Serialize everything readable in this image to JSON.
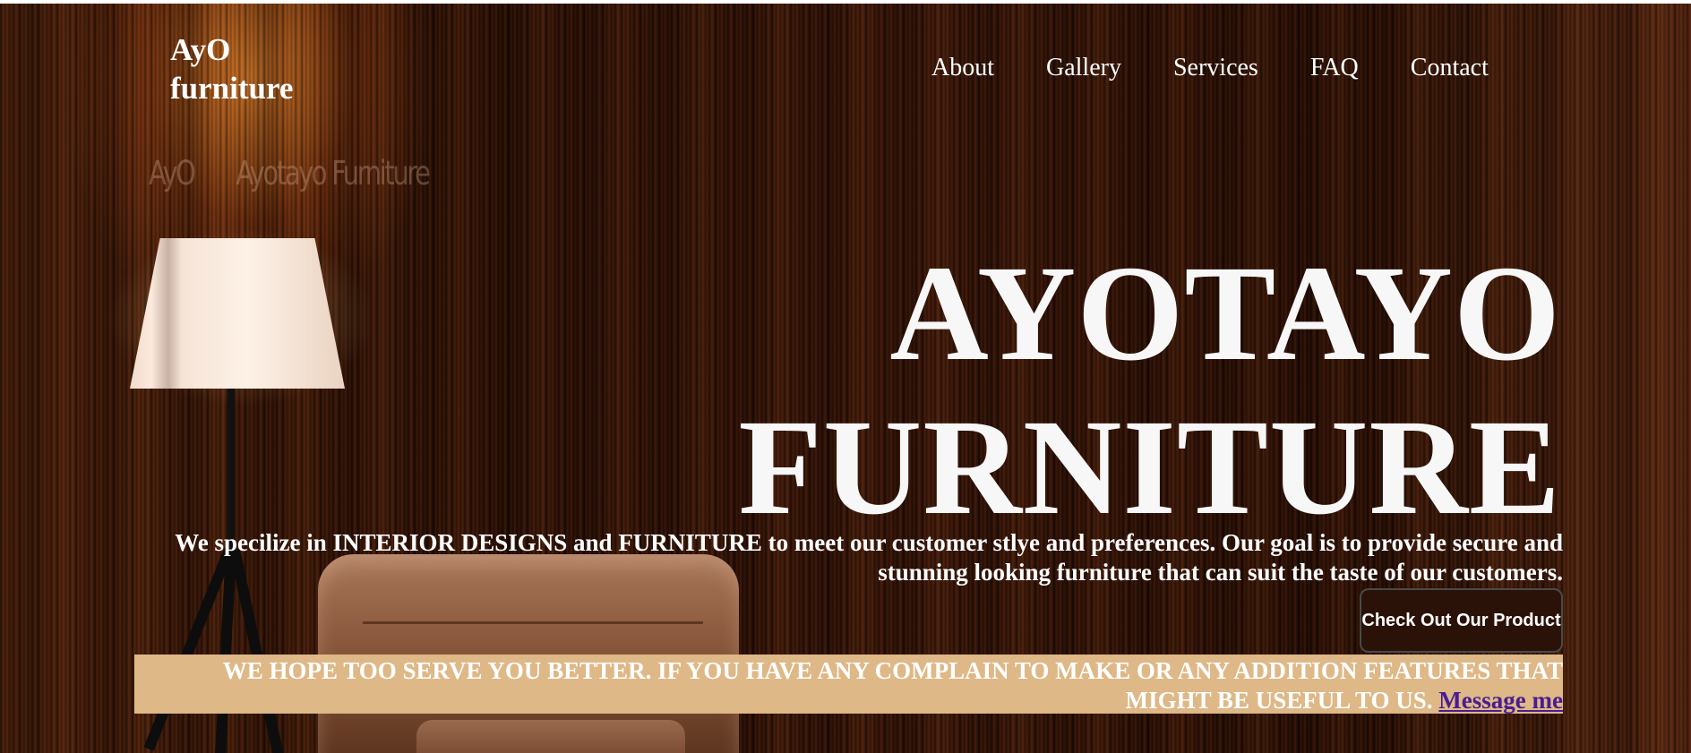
{
  "header": {
    "logo_line1": "AyO",
    "logo_line2": "furniture",
    "nav": [
      {
        "label": "About"
      },
      {
        "label": "Gallery"
      },
      {
        "label": "Services"
      },
      {
        "label": "FAQ"
      },
      {
        "label": "Contact"
      }
    ]
  },
  "watermark": {
    "left": "AyO",
    "right": "Ayotayo Furniture"
  },
  "hero": {
    "title_line1": "AYOTAYO",
    "title_line2": "FURNITURE",
    "tagline": "We specilize in INTERIOR DESIGNS and FURNITURE to meet our customer stlye and preferences. Our goal is to provide secure and stunning looking furniture that can suit the taste of our customers.",
    "cta_label": "Check Out Our Product"
  },
  "banner": {
    "text": "WE HOPE TOO SERVE YOU BETTER. IF YOU HAVE ANY COMPLAIN TO MAKE OR ANY ADDITION FEATURES THAT MIGHT BE USEFUL TO US.",
    "link_label": "Message me"
  },
  "colors": {
    "banner_bg": "#deb887",
    "cta_bg": "#2b1208",
    "link": "#4b1d8f",
    "text": "#ffffff"
  }
}
